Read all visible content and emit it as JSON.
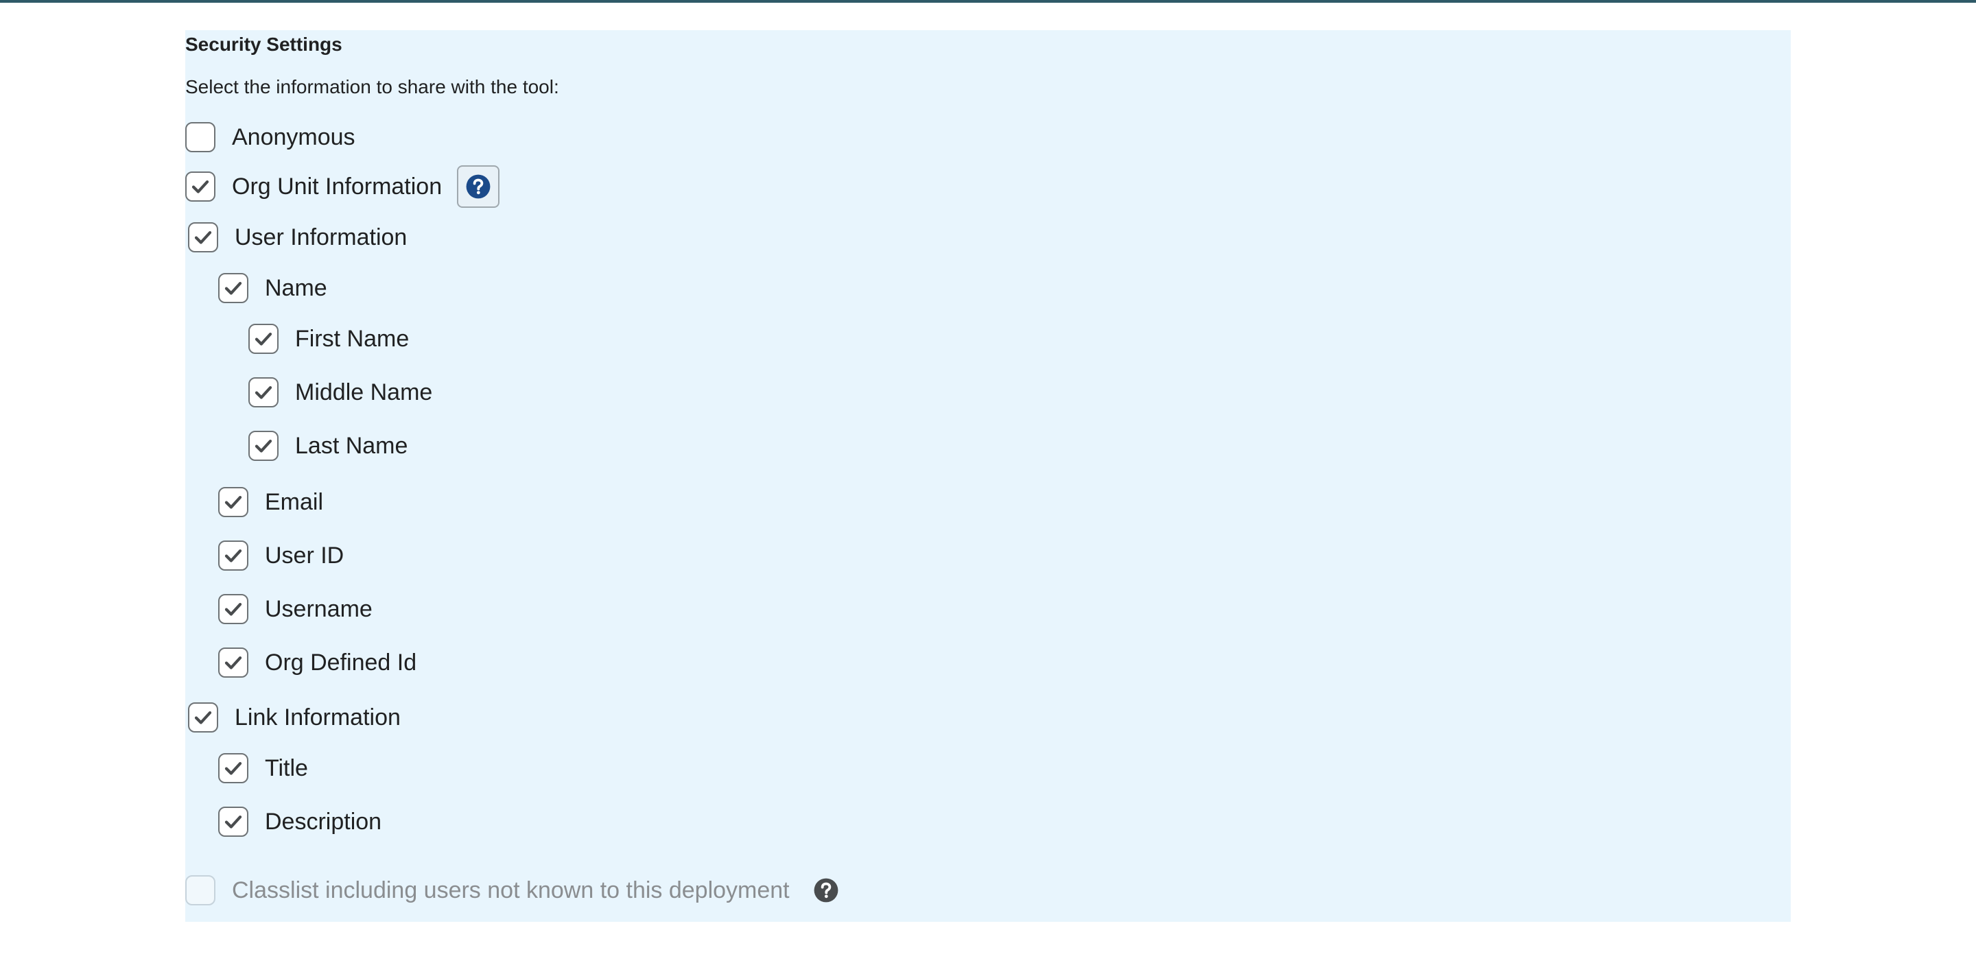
{
  "section": {
    "title": "Security Settings",
    "instruction": "Select the information to share with the tool:"
  },
  "options": {
    "anonymous": {
      "label": "Anonymous",
      "checked": false
    },
    "org_unit": {
      "label": "Org Unit Information",
      "checked": true,
      "help_icon": "help-icon"
    },
    "user_info": {
      "label": "User Information",
      "checked": true
    },
    "name": {
      "label": "Name",
      "checked": true
    },
    "first_name": {
      "label": "First Name",
      "checked": true
    },
    "middle_name": {
      "label": "Middle Name",
      "checked": true
    },
    "last_name": {
      "label": "Last Name",
      "checked": true
    },
    "email": {
      "label": "Email",
      "checked": true
    },
    "user_id": {
      "label": "User ID",
      "checked": true
    },
    "username": {
      "label": "Username",
      "checked": true
    },
    "org_defined_id": {
      "label": "Org Defined Id",
      "checked": true
    },
    "link_info": {
      "label": "Link Information",
      "checked": true
    },
    "title": {
      "label": "Title",
      "checked": true
    },
    "description": {
      "label": "Description",
      "checked": true
    },
    "classlist": {
      "label": "Classlist including users not known to this deployment",
      "checked": false,
      "disabled": true,
      "help_icon": "help-icon"
    }
  },
  "colors": {
    "panel_bg": "#e8f5fd",
    "top_bar": "#2f5a68",
    "help_blue": "#1b4a8a",
    "help_dark": "#494c4e",
    "checkmark": "#494c4e"
  }
}
